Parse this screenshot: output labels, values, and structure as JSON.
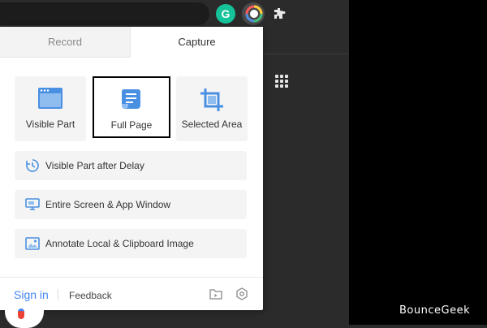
{
  "popup": {
    "tabs": [
      {
        "label": "Record",
        "active": false
      },
      {
        "label": "Capture",
        "active": true
      }
    ],
    "tiles": [
      {
        "label": "Visible Part",
        "icon": "browser-window-icon"
      },
      {
        "label": "Full Page",
        "icon": "scroll-page-icon",
        "selected": true
      },
      {
        "label": "Selected Area",
        "icon": "crop-icon"
      }
    ],
    "rows": [
      {
        "label": "Visible Part after Delay",
        "icon": "timer-icon"
      },
      {
        "label": "Entire Screen & App Window",
        "icon": "monitor-icon"
      },
      {
        "label": "Annotate Local & Clipboard Image",
        "icon": "image-icon"
      }
    ],
    "footer": {
      "signin": "Sign in",
      "feedback": "Feedback"
    }
  },
  "browser": {
    "grammarly_letter": "G"
  },
  "watermark": "BounceGeek",
  "colors": {
    "accent": "#4285f4",
    "icon_blue": "#4a90e2",
    "tile_bg": "#f4f4f4"
  }
}
